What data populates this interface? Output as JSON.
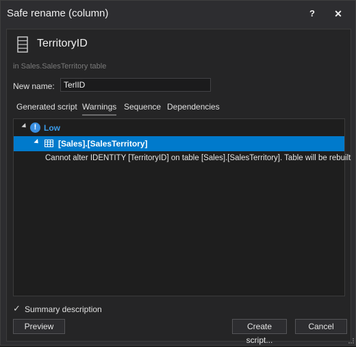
{
  "window": {
    "title": "Safe rename (column)",
    "help_label": "?",
    "close_label": "✕"
  },
  "header": {
    "title": "TerritoryID",
    "icon": "column-icon",
    "subtitle": "in Sales.SalesTerritory table"
  },
  "new_name": {
    "label": "New name:",
    "value": "TerlID"
  },
  "tabs": [
    {
      "label": "Generated script"
    },
    {
      "label": "Warnings",
      "active": true
    },
    {
      "label": "Sequence"
    },
    {
      "label": "Dependencies"
    }
  ],
  "warnings": {
    "group_label": "Low",
    "group_icon": "info-icon",
    "object_label": "[Sales].[SalesTerritory]",
    "object_icon": "table-icon",
    "message": "Cannot alter IDENTITY [TerritoryID] on table [Sales].[SalesTerritory]. Table will be rebuilt"
  },
  "summary": {
    "label": "Summary description",
    "checked": true
  },
  "buttons": {
    "preview": "Preview",
    "create_script": "Create script...",
    "cancel": "Cancel"
  },
  "colors": {
    "selection": "#007acc",
    "low_severity": "#3a9be8",
    "background": "#2d2d30"
  }
}
